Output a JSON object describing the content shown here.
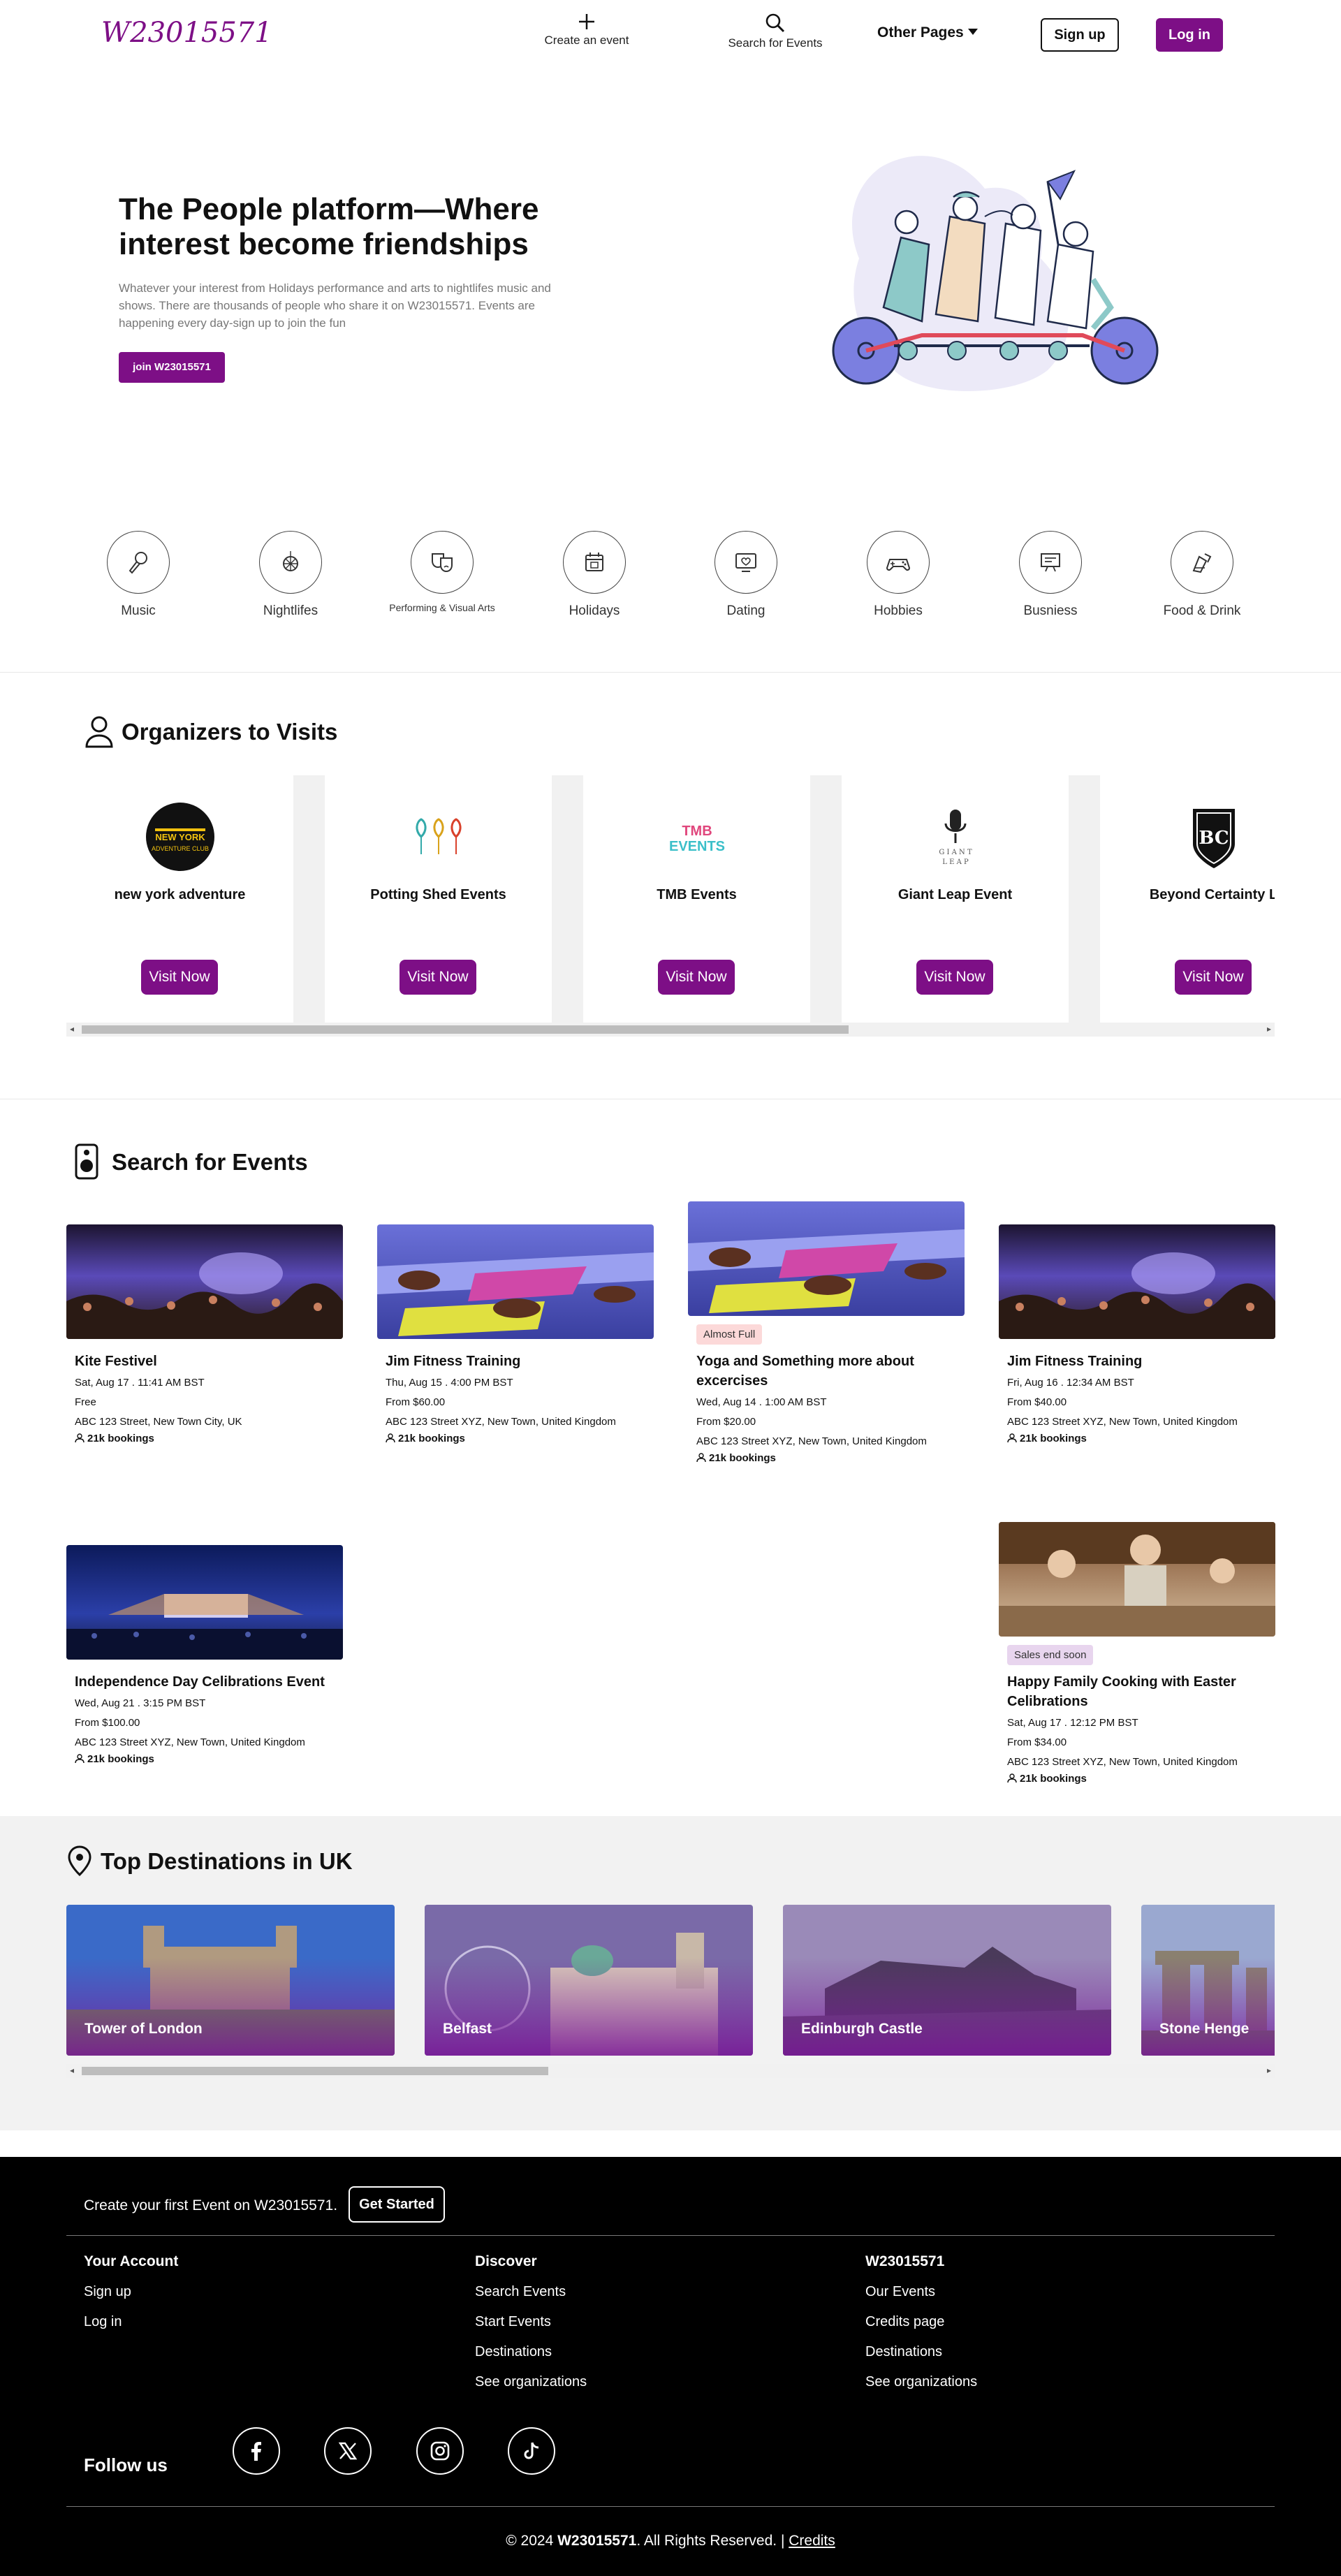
{
  "brand": {
    "logo": "W23015571",
    "accent": "#7d0f86"
  },
  "nav": {
    "create_label": "Create an event",
    "search_label": "Search for Events",
    "other_pages": "Other Pages",
    "signup": "Sign up",
    "login": "Log in"
  },
  "hero": {
    "title": "The People platform—Where interest become friendships",
    "description": "Whatever your interest from Holidays performance and arts to nightlifes music and shows. There are thousands of people who share it on W23015571. Events are happening every day-sign up to join the fun",
    "button": "join W23015571"
  },
  "categories": [
    {
      "label": "Music",
      "icon": "microphone-icon"
    },
    {
      "label": "Nightlifes",
      "icon": "disco-ball-icon"
    },
    {
      "label": "Performing & Visual Arts",
      "icon": "theater-masks-icon"
    },
    {
      "label": "Holidays",
      "icon": "calendar-icon"
    },
    {
      "label": "Dating",
      "icon": "heart-screen-icon"
    },
    {
      "label": "Hobbies",
      "icon": "gamepad-icon"
    },
    {
      "label": "Busniess",
      "icon": "presentation-icon"
    },
    {
      "label": "Food & Drink",
      "icon": "drink-icon"
    }
  ],
  "organizers": {
    "title": "Organizers to Visits",
    "button": "Visit Now",
    "items": [
      {
        "name": "new york adventure",
        "logo_text": "NEW YORK ADVENTURE CLUB"
      },
      {
        "name": "Potting Shed Events",
        "logo_text": ""
      },
      {
        "name": "TMB Events",
        "logo_text": "TMB EVENTS"
      },
      {
        "name": "Giant Leap Event",
        "logo_text": "GIANT LEAP"
      },
      {
        "name": "Beyond Certainty L",
        "logo_text": "BC"
      }
    ]
  },
  "events": {
    "title": "Search for Events",
    "items": [
      {
        "title": "Kite Festivel",
        "date": "Sat, Aug 17 . 11:41 AM BST",
        "price": "Free",
        "address": "ABC 123 Street, New Town City, UK",
        "bookings": "21k bookings",
        "badge": "",
        "image": "concert-crowd"
      },
      {
        "title": "Jim Fitness Training",
        "date": "Thu, Aug 15 . 4:00 PM BST",
        "price": "From $60.00",
        "address": "ABC 123 Street XYZ, New Town, United Kingdom",
        "bookings": "21k bookings",
        "badge": "",
        "image": "yoga-class"
      },
      {
        "title": "Yoga and Something more about excercises",
        "date": "Wed, Aug 14 . 1:00 AM BST",
        "price": "From $20.00",
        "address": "ABC 123 Street XYZ, New Town, United Kingdom",
        "bookings": "21k bookings",
        "badge": "Almost Full",
        "image": "yoga-class"
      },
      {
        "title": "Jim Fitness Training",
        "date": "Fri, Aug 16 . 12:34 AM BST",
        "price": "From $40.00",
        "address": "ABC 123 Street XYZ, New Town, United Kingdom",
        "bookings": "21k bookings",
        "badge": "",
        "image": "concert-crowd"
      },
      {
        "title": "Independence Day Celibrations Event",
        "date": "Wed, Aug 21 . 3:15 PM BST",
        "price": "From $100.00",
        "address": "ABC 123 Street XYZ, New Town, United Kingdom",
        "bookings": "21k bookings",
        "badge": "",
        "image": "stage-concert"
      },
      {
        "title": "Happy Family Cooking with Easter Celibrations",
        "date": "Sat, Aug 17 . 12:12 PM BST",
        "price": "From $34.00",
        "address": "ABC 123 Street XYZ, New Town, United Kingdom",
        "bookings": "21k bookings",
        "badge": "Sales end soon",
        "image": "cooking-family"
      }
    ]
  },
  "destinations": {
    "title": "Top Destinations in UK",
    "items": [
      {
        "name": "Tower of London"
      },
      {
        "name": "Belfast"
      },
      {
        "name": "Edinburgh Castle"
      },
      {
        "name": "Stone Henge"
      }
    ]
  },
  "footer": {
    "cta_text": "Create your first Event on W23015571.",
    "cta_button": "Get Started",
    "columns": [
      {
        "heading": "Your Account",
        "items": [
          "Sign up",
          "Log in"
        ]
      },
      {
        "heading": "Discover",
        "items": [
          "Search Events",
          "Start Events",
          "Destinations",
          "See organizations"
        ]
      },
      {
        "heading": "W23015571",
        "items": [
          "Our Events",
          "Credits page",
          "Destinations",
          "See organizations"
        ]
      }
    ],
    "follow": "Follow us",
    "social": [
      "facebook-icon",
      "x-icon",
      "instagram-icon",
      "tiktok-icon"
    ],
    "copyright_prefix": "© 2024",
    "copyright_brand": "W23015571",
    "copyright_suffix": ". All Rights Reserved. |",
    "credits": "Credits"
  }
}
